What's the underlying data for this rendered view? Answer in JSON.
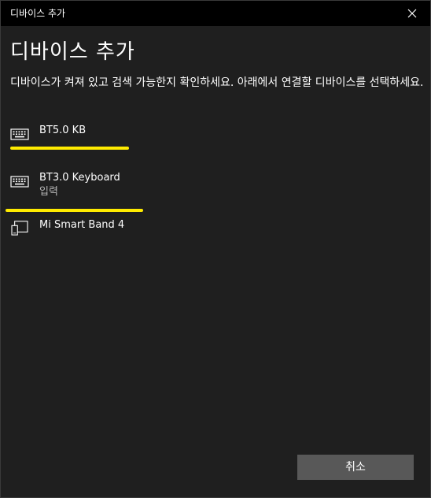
{
  "window": {
    "title": "디바이스 추가"
  },
  "dialog": {
    "heading": "디바이스 추가",
    "instruction": "디바이스가 켜져 있고 검색 가능한지 확인하세요. 아래에서 연결할 디바이스를 선택하세요."
  },
  "devices": [
    {
      "name": "BT5.0 KB",
      "subtitle": "",
      "icon": "keyboard-icon"
    },
    {
      "name": "BT3.0 Keyboard",
      "subtitle": "입력",
      "icon": "keyboard-icon"
    },
    {
      "name": "Mi Smart Band 4",
      "subtitle": "",
      "icon": "devices-icon"
    }
  ],
  "buttons": {
    "cancel_label": "취소"
  },
  "colors": {
    "background": "#1f1f1f",
    "titlebar": "#000000",
    "highlight": "#ffeb00",
    "button": "#585858",
    "secondary_text": "#b8b8b8"
  }
}
